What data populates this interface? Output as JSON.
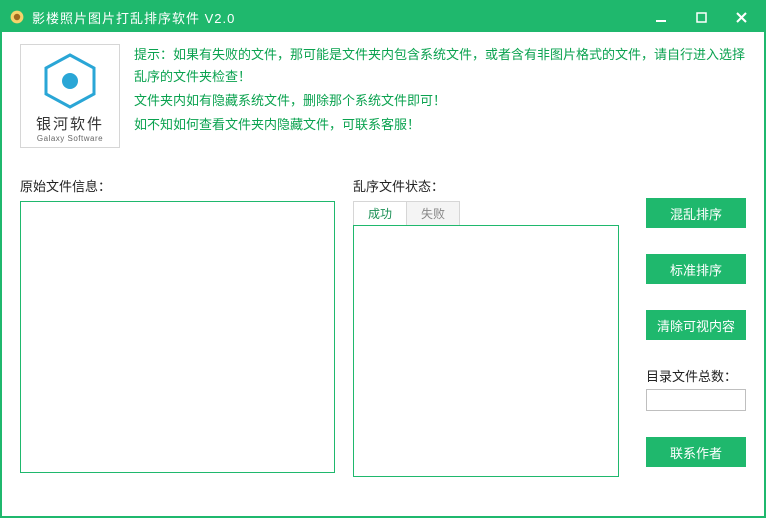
{
  "titlebar": {
    "title": "影楼照片图片打乱排序软件 V2.0"
  },
  "logo": {
    "cn": "银河软件",
    "en": "Galaxy Software"
  },
  "tips": {
    "line1": "提示：如果有失败的文件，那可能是文件夹内包含系统文件，或者含有非图片格式的文件，请自行进入选择乱序的文件夹检查！",
    "line2": "文件夹内如有隐藏系统文件，删除那个系统文件即可！",
    "line3": "如不知如何查看文件夹内隐藏文件，可联系客服！"
  },
  "sections": {
    "original_label": "原始文件信息：",
    "shuffled_label": "乱序文件状态："
  },
  "tabs": {
    "success": "成功",
    "fail": "失败"
  },
  "buttons": {
    "shuffle": "混乱排序",
    "standard": "标准排序",
    "clear": "清除可视内容",
    "contact": "联系作者"
  },
  "count": {
    "label": "目录文件总数：",
    "value": ""
  }
}
